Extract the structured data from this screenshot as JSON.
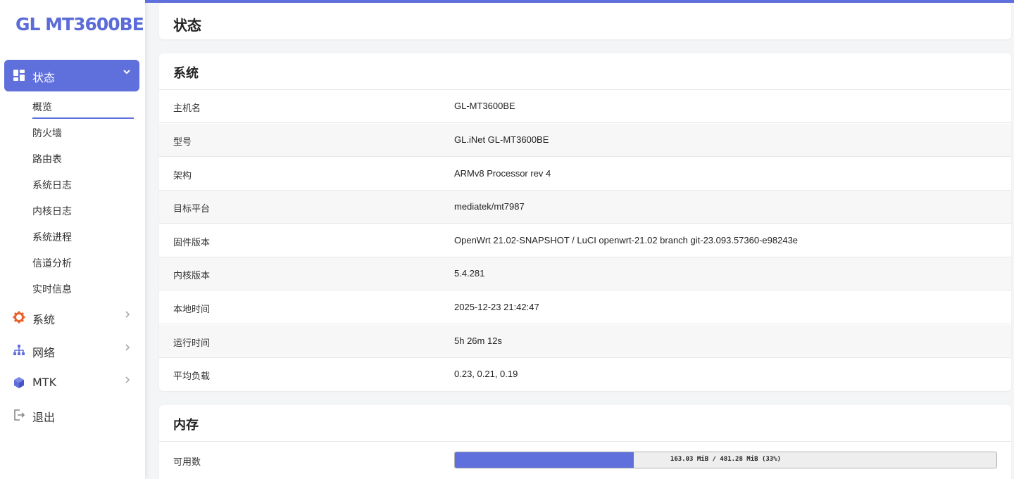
{
  "brand": {
    "logo": "GL MT3600BE",
    "accent": "#5f6fdc"
  },
  "sidebar": {
    "active": {
      "label": "状态",
      "icon": "dashboard-icon",
      "chevron": "chevron-down-icon"
    },
    "sub_items": [
      "概览",
      "防火墙",
      "路由表",
      "系统日志",
      "内核日志",
      "系统进程",
      "信道分析",
      "实时信息"
    ],
    "items": [
      {
        "label": "系统",
        "icon": "gear-icon",
        "chevron": "chevron-right-icon"
      },
      {
        "label": "网络",
        "icon": "network-icon",
        "chevron": "chevron-right-icon"
      },
      {
        "label": "MTK",
        "icon": "cube-icon",
        "chevron": "chevron-right-icon"
      },
      {
        "label": "退出",
        "icon": "logout-icon"
      }
    ]
  },
  "page": {
    "title": "状态"
  },
  "system": {
    "title": "系统",
    "rows": [
      {
        "key": "主机名",
        "value": "GL-MT3600BE"
      },
      {
        "key": "型号",
        "value": "GL.iNet GL-MT3600BE"
      },
      {
        "key": "架构",
        "value": "ARMv8 Processor rev 4"
      },
      {
        "key": "目标平台",
        "value": "mediatek/mt7987"
      },
      {
        "key": "固件版本",
        "value": "OpenWrt 21.02-SNAPSHOT / LuCI openwrt-21.02 branch git-23.093.57360-e98243e"
      },
      {
        "key": "内核版本",
        "value": "5.4.281"
      },
      {
        "key": "本地时间",
        "value": "2025-12-23 21:42:47"
      },
      {
        "key": "运行时间",
        "value": "5h 26m 12s"
      },
      {
        "key": "平均负载",
        "value": "0.23, 0.21, 0.19"
      }
    ]
  },
  "memory": {
    "title": "内存",
    "rows": [
      {
        "key": "可用数",
        "progress_text": "163.03 MiB / 481.28 MiB (33%)",
        "progress_percent": 33
      }
    ]
  }
}
